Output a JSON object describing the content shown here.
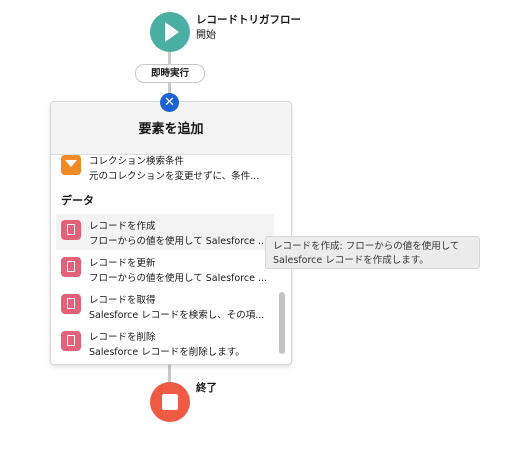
{
  "start": {
    "title": "レコードトリガフロー",
    "subtitle": "開始"
  },
  "trigger_pill": "即時実行",
  "panel": {
    "title": "要素を追加",
    "partial_item": {
      "label": "コレクション検索条件",
      "description": "元のコレクションを変更せずに、条件..."
    },
    "section_label": "データ",
    "items": [
      {
        "label": "レコードを作成",
        "description": "フローからの値を使用して Salesforce ...",
        "icon": "record-create-icon"
      },
      {
        "label": "レコードを更新",
        "description": "フローからの値を使用して Salesforce ...",
        "icon": "record-update-icon"
      },
      {
        "label": "レコードを取得",
        "description": "Salesforce レコードを検索し、その項...",
        "icon": "record-lookup-icon"
      },
      {
        "label": "レコードを削除",
        "description": "Salesforce レコードを削除します。",
        "icon": "record-delete-icon"
      }
    ]
  },
  "tooltip": {
    "line1": "レコードを作成: フローからの値を使用して",
    "line2": "Salesforce レコードを作成します。"
  },
  "end": {
    "label": "終了"
  },
  "colors": {
    "start_node": "#4aaea3",
    "end_node": "#ef5a45",
    "close_button": "#1b63d4",
    "record_icon": "#e3627a",
    "filter_icon": "#f08a24"
  }
}
